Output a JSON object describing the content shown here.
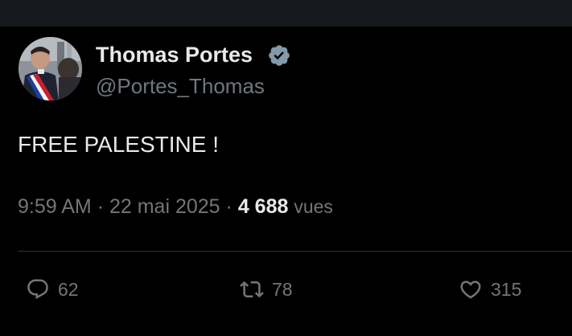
{
  "tweet": {
    "author": {
      "display_name": "Thomas Portes",
      "handle": "@Portes_Thomas",
      "verified": true
    },
    "text": "FREE PALESTINE !",
    "meta": {
      "time": "9:59 AM",
      "separator": "·",
      "date": "22 mai 2025",
      "views_count": "4 688",
      "views_label": "vues"
    },
    "actions": {
      "replies": "62",
      "retweets": "78",
      "likes": "315"
    }
  },
  "colors": {
    "background": "#000000",
    "top_band": "#15181c",
    "primary_text": "#e7e9ea",
    "secondary_text": "#71767b",
    "verified_badge": "#829aab",
    "divider": "#2f3336"
  },
  "icons": {
    "verified": "verified-badge-icon",
    "reply": "speech-bubble-icon",
    "retweet": "retweet-arrows-icon",
    "like": "heart-icon"
  }
}
